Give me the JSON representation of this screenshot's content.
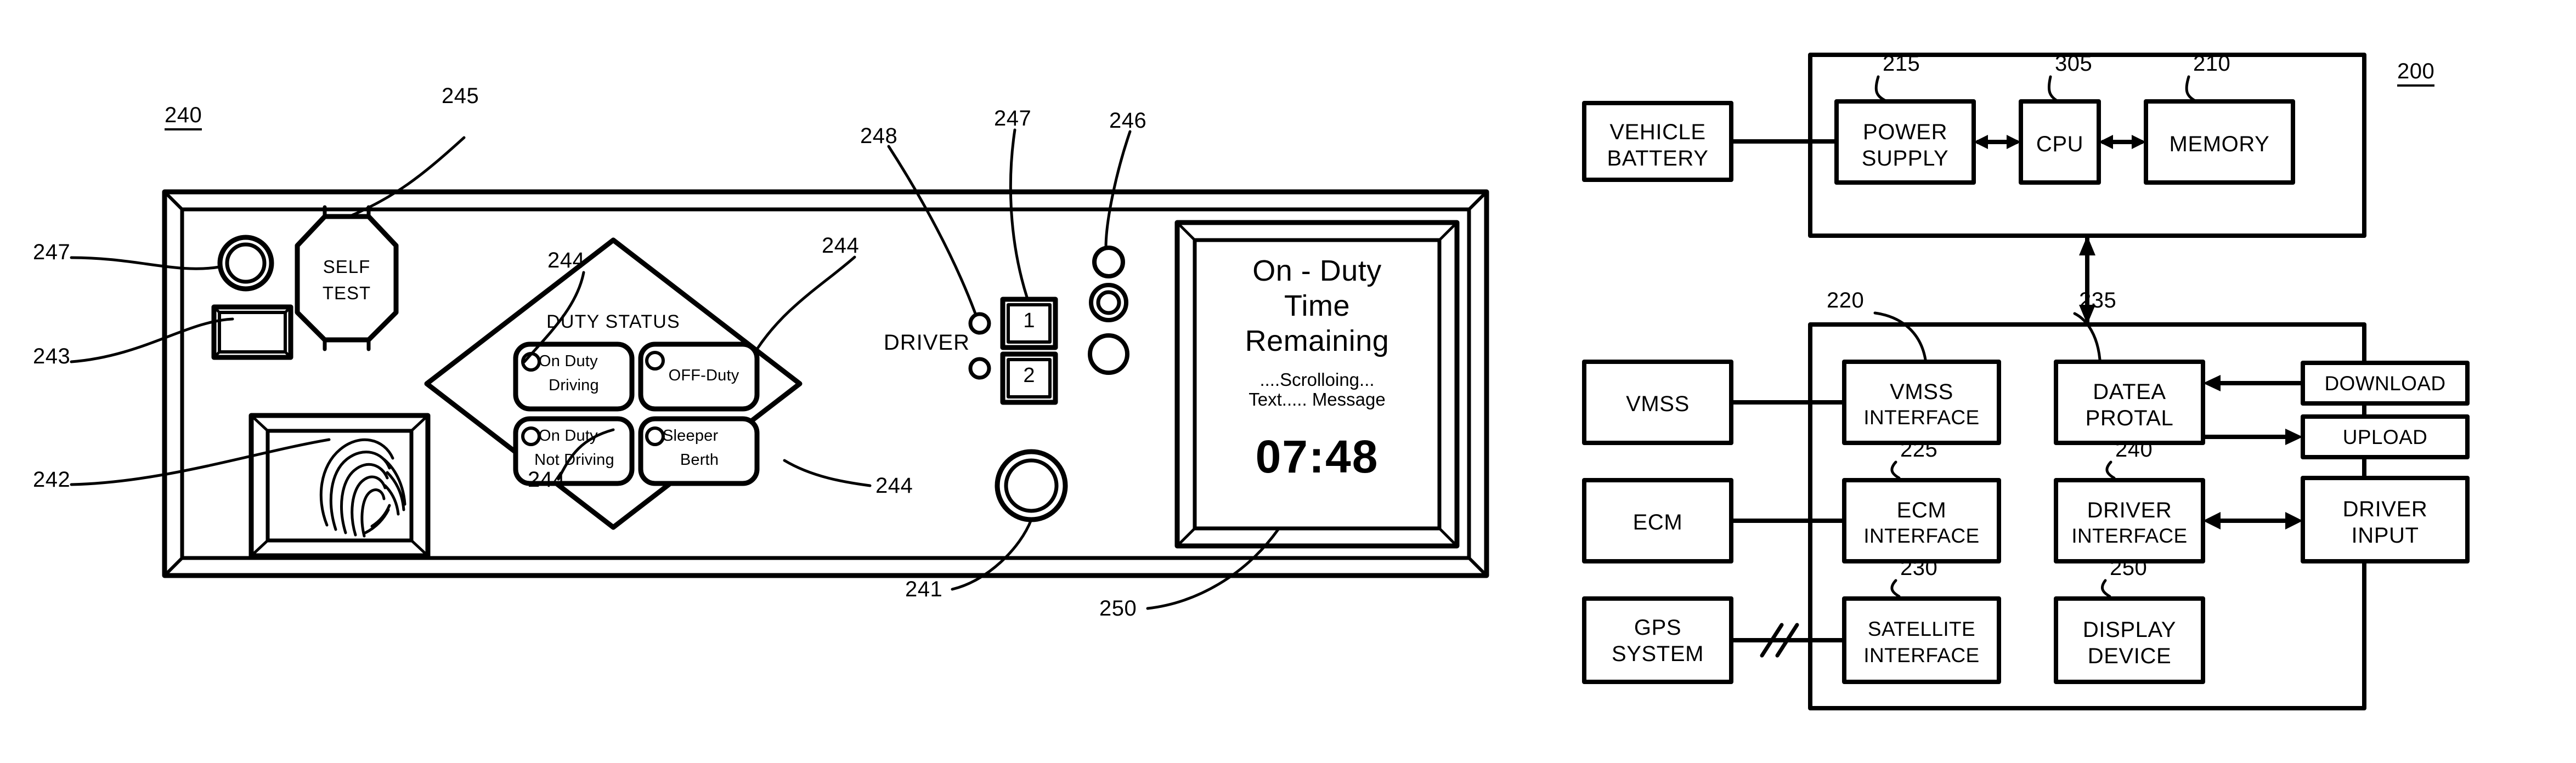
{
  "figure": {
    "left_panel": {
      "ref_main": "240",
      "self_test_button": {
        "line1": "SELF",
        "line2": "TEST",
        "ref": "245"
      },
      "refs": {
        "indicator_led_top_left": "247",
        "slot_reader": "243",
        "fingerprint_scanner": "242",
        "duty_status_buttons": "244",
        "driver_led": "248",
        "driver_button_led": "247",
        "status_led_group": "246",
        "round_button": "241",
        "display": "250"
      },
      "duty_status": {
        "header": "DUTY STATUS",
        "buttons": [
          {
            "line1": "On Duty",
            "line2": "Driving"
          },
          {
            "line1": "OFF-Duty",
            "line2": ""
          },
          {
            "line1": "On Duty",
            "line2": "Not Driving"
          },
          {
            "line1": "Sleeper",
            "line2": "Berth"
          }
        ]
      },
      "driver_select": {
        "label": "DRIVER",
        "buttons": [
          "1",
          "2"
        ]
      },
      "display": {
        "title_line1": "On - Duty",
        "title_line2": "Time",
        "title_line3": "Remaining",
        "scroll_line1": "....Scrolloing...",
        "scroll_line2": "Text..... Message",
        "time_value": "07:48"
      }
    },
    "block_diagram": {
      "ref_main": "200",
      "upper_group": {
        "blocks": [
          {
            "label_line1": "POWER",
            "label_line2": "SUPPLY",
            "ref": "215"
          },
          {
            "label_line1": "CPU",
            "label_line2": "",
            "ref": "305"
          },
          {
            "label_line1": "MEMORY",
            "label_line2": "",
            "ref": "210"
          }
        ]
      },
      "external_left_upper": {
        "label_line1": "VEHICLE",
        "label_line2": "BATTERY"
      },
      "lower_group": {
        "blocks": [
          {
            "label_line1": "VMSS",
            "label_line2": "INTERFACE",
            "ref": "220"
          },
          {
            "label_line1": "DATEA",
            "label_line2": "PROTAL",
            "ref": "235"
          },
          {
            "label_line1": "ECM",
            "label_line2": "INTERFACE",
            "ref": "225"
          },
          {
            "label_line1": "DRIVER",
            "label_line2": "INTERFACE",
            "ref": "240"
          },
          {
            "label_line1": "SATELLITE",
            "label_line2": "INTERFACE",
            "ref": "230"
          },
          {
            "label_line1": "DISPLAY",
            "label_line2": "DEVICE",
            "ref": "250"
          }
        ]
      },
      "external_left": [
        {
          "label_line1": "VMSS",
          "label_line2": ""
        },
        {
          "label_line1": "ECM",
          "label_line2": ""
        },
        {
          "label_line1": "GPS",
          "label_line2": "SYSTEM"
        }
      ],
      "external_right": [
        {
          "label_line1": "DOWNLOAD",
          "label_line2": ""
        },
        {
          "label_line1": "UPLOAD",
          "label_line2": ""
        },
        {
          "label_line1": "DRIVER",
          "label_line2": "INPUT"
        }
      ]
    }
  },
  "colors": {
    "ink": "#000000",
    "paper": "#ffffff"
  }
}
